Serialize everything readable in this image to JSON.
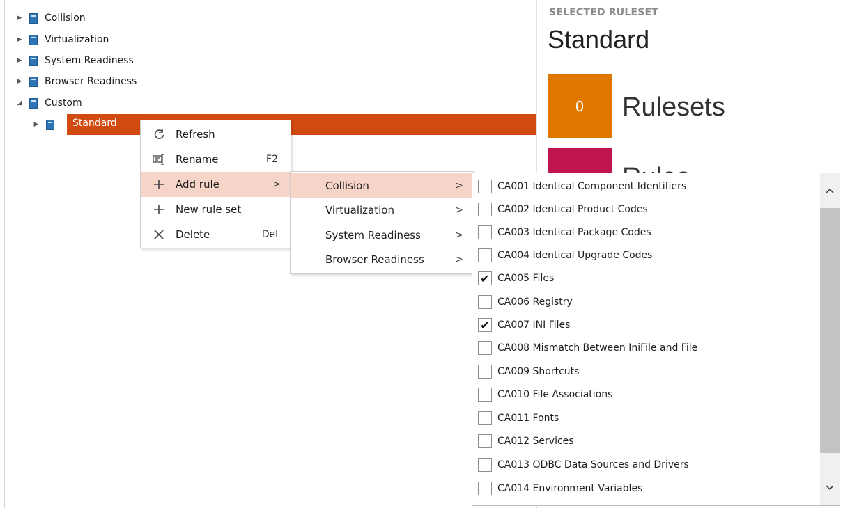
{
  "tree": {
    "items": [
      {
        "label": "Collision",
        "expanded": false
      },
      {
        "label": "Virtualization",
        "expanded": false
      },
      {
        "label": "System Readiness",
        "expanded": false
      },
      {
        "label": "Browser Readiness",
        "expanded": false
      },
      {
        "label": "Custom",
        "expanded": true
      }
    ],
    "selected_child": {
      "label": "Standard"
    }
  },
  "right_panel": {
    "caption": "SELECTED RULESET",
    "title": "Standard",
    "tiles": [
      {
        "count": "0",
        "label": "Rulesets",
        "color": "#e07800"
      },
      {
        "count": "",
        "label": "Rules",
        "color": "#c0154d"
      }
    ]
  },
  "context_menu": {
    "items": [
      {
        "icon": "refresh-icon",
        "label": "Refresh",
        "shortcut": ""
      },
      {
        "icon": "rename-icon",
        "label": "Rename",
        "shortcut": "F2"
      },
      {
        "icon": "plus-icon",
        "label": "Add rule",
        "shortcut": "",
        "submenu": true
      },
      {
        "icon": "plus-icon",
        "label": "New rule set",
        "shortcut": ""
      },
      {
        "icon": "close-icon",
        "label": "Delete",
        "shortcut": "Del"
      }
    ]
  },
  "add_rule_submenu": {
    "items": [
      {
        "label": "Collision"
      },
      {
        "label": "Virtualization"
      },
      {
        "label": "System Readiness"
      },
      {
        "label": "Browser Readiness"
      }
    ]
  },
  "rules": {
    "items": [
      {
        "label": "CA001 Identical Component Identifiers",
        "checked": false
      },
      {
        "label": "CA002 Identical Product Codes",
        "checked": false
      },
      {
        "label": "CA003 Identical Package Codes",
        "checked": false
      },
      {
        "label": "CA004 Identical Upgrade Codes",
        "checked": false
      },
      {
        "label": "CA005 Files",
        "checked": true
      },
      {
        "label": "CA006 Registry",
        "checked": false
      },
      {
        "label": "CA007 INI Files",
        "checked": true
      },
      {
        "label": "CA008 Mismatch Between IniFile and File",
        "checked": false
      },
      {
        "label": "CA009 Shortcuts",
        "checked": false
      },
      {
        "label": "CA010 File Associations",
        "checked": false
      },
      {
        "label": "CA011 Fonts",
        "checked": false
      },
      {
        "label": "CA012 Services",
        "checked": false
      },
      {
        "label": "CA013 ODBC Data Sources and Drivers",
        "checked": false
      },
      {
        "label": "CA014 Environment Variables",
        "checked": false
      }
    ],
    "scroll_up_glyph": "^",
    "scroll_down_glyph": "v"
  },
  "colors": {
    "selection": "#d14a0f",
    "menu_hover": "#f6d5c8",
    "book_icon": "#2e75b6"
  }
}
